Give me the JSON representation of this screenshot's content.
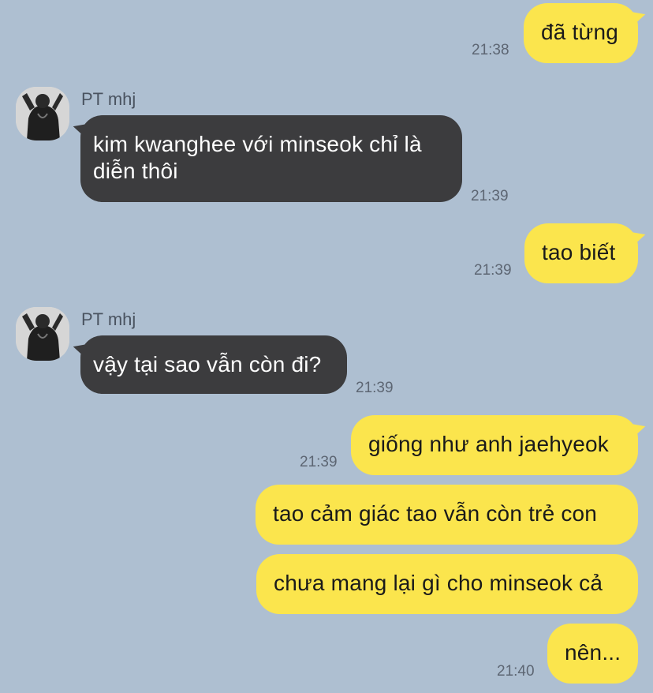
{
  "contact": {
    "name": "PT mhj",
    "avatar_icon": "profile-photo-icon"
  },
  "colors": {
    "background": "#aebfd1",
    "outgoing_bubble": "#fbe54d",
    "incoming_bubble": "#3c3c3e"
  },
  "messages": [
    {
      "direction": "outgoing",
      "text": "đã từng",
      "time": "21:38"
    },
    {
      "direction": "incoming",
      "sender": "PT mhj",
      "text_line1": "kim kwanghee với minseok chỉ là",
      "text_line2": "diễn thôi",
      "time": "21:39"
    },
    {
      "direction": "outgoing",
      "text": "tao biết",
      "time": "21:39"
    },
    {
      "direction": "incoming",
      "sender": "PT mhj",
      "text": "vậy tại sao vẫn còn đi?",
      "time": "21:39"
    },
    {
      "direction": "outgoing",
      "text": "giống như anh jaehyeok",
      "time": "21:39"
    },
    {
      "direction": "outgoing",
      "text": "tao cảm giác tao vẫn còn trẻ con"
    },
    {
      "direction": "outgoing",
      "text": "chưa mang lại gì cho minseok cả"
    },
    {
      "direction": "outgoing",
      "text": "nên...",
      "time": "21:40"
    }
  ]
}
